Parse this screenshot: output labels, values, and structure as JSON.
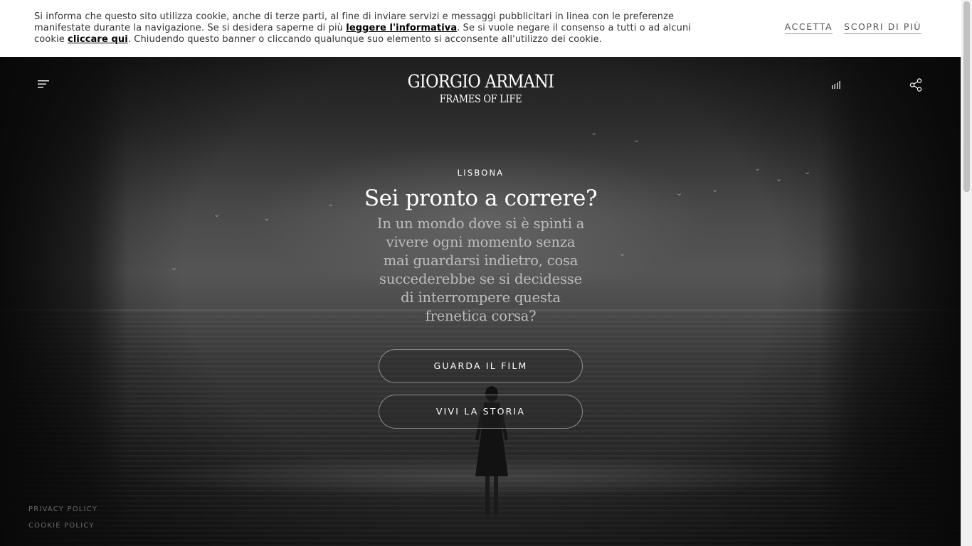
{
  "cookie_banner": {
    "text_part1": "Si informa che questo sito utilizza cookie, anche di terze parti, al fine di inviare servizi e messaggi pubblicitari in linea con le preferenze manifestate durante la navigazione. Se si desidera saperne di più ",
    "link_informativa": "leggere l'informativa",
    "text_part2": ". Se si vuole negare il consenso a tutti o ad alcuni cookie ",
    "link_cliccare": "cliccare qui",
    "text_part3": ". Chiudendo questo banner o cliccando qualunque suo elemento si acconsente all'utilizzo dei cookie.",
    "accept_label": "ACCETTA",
    "learn_more_label": "SCOPRI DI PIÙ"
  },
  "header": {
    "menu_icon": "hamburger-menu-icon",
    "logo_line1": "GIORGIO ARMANI",
    "logo_line2": "FRAMES OF LIFE",
    "audio_icon": "audio-bars-icon",
    "share_icon": "share-icon"
  },
  "hero": {
    "location": "LISBONA",
    "headline": "Sei pronto a correre?",
    "subtitle": "In un mondo dove si è spinti a vivere ogni momento senza mai guardarsi indietro, cosa succederebbe se si decidesse di interrompere questa frenetica corsa?",
    "cta_film": "GUARDA IL FILM",
    "cta_story": "VIVI LA STORIA"
  },
  "footer": {
    "privacy_policy": "PRIVACY POLICY",
    "cookie_policy": "COOKIE POLICY"
  },
  "colors": {
    "banner_bg": "#ffffff",
    "hero_text": "#ffffff",
    "subtitle_text": "#bdbdbd",
    "footer_link": "#6a6a6a"
  }
}
